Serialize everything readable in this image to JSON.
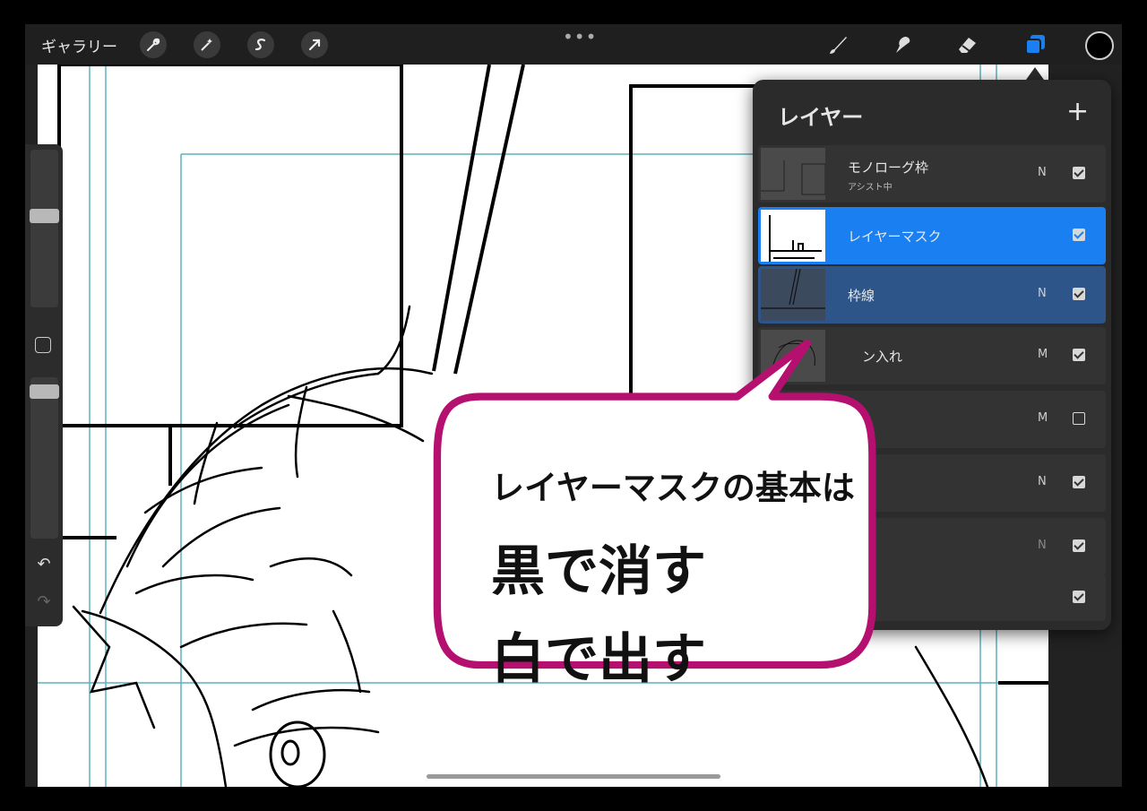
{
  "topbar": {
    "gallery_label": "ギャラリー",
    "more_label": "•••"
  },
  "icons": {
    "actions": "wrench-icon",
    "adjustments": "magic-wand-icon",
    "selection": "selection-s-icon",
    "transform": "arrow-cursor-icon",
    "brush": "brush-icon",
    "smudge": "smudge-icon",
    "eraser": "eraser-icon",
    "layers": "layers-icon"
  },
  "colors": {
    "accent": "#1a7ff0",
    "selected_layer_child": "#2e5589",
    "bubble_border": "#b5106f",
    "current_color": "#000000"
  },
  "layers_panel": {
    "title": "レイヤー",
    "add_label": "+",
    "layers": [
      {
        "name": "モノローグ枠",
        "sub": "アシスト中",
        "mode": "N",
        "visible": true
      },
      {
        "name": "レイヤーマスク",
        "sub": "",
        "mode": "",
        "visible": true
      },
      {
        "name": "枠線",
        "sub": "",
        "mode": "N",
        "visible": true
      },
      {
        "name": "ン入れ",
        "sub": "",
        "mode": "M",
        "visible": true
      },
      {
        "name": "",
        "sub": "",
        "mode": "M",
        "visible": false
      },
      {
        "name": "",
        "sub": "",
        "mode": "N",
        "visible": true
      },
      {
        "name": "",
        "sub": "",
        "mode": "N",
        "visible": true
      },
      {
        "name": "",
        "sub": "",
        "mode": "",
        "visible": true
      }
    ]
  },
  "callout": {
    "line1": "レイヤーマスクの基本は",
    "line2": "黒で消す",
    "line3": "白で出す"
  },
  "sidebar": {
    "undo_label": "↶",
    "redo_label": "↷"
  }
}
